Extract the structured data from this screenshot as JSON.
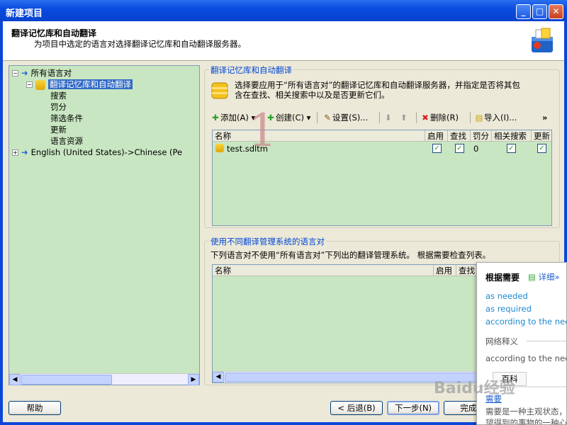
{
  "window": {
    "title": "新建项目"
  },
  "header": {
    "title": "翻译记忆库和自动翻译",
    "subtitle": "为项目中选定的语言对选择翻译记忆库和自动翻译服务器。"
  },
  "tree": {
    "items": [
      {
        "label": "所有语言对"
      },
      {
        "label": "翻译记忆库和自动翻译"
      },
      {
        "label": "搜索"
      },
      {
        "label": "罚分"
      },
      {
        "label": "筛选条件"
      },
      {
        "label": "更新"
      },
      {
        "label": "语言资源"
      },
      {
        "label": "English (United States)->Chinese (Pe"
      }
    ]
  },
  "tm_group": {
    "label": "翻译记忆库和自动翻译",
    "description_line1": "选择要应用于“所有语言对”的翻译记忆库和自动翻译服务器，并指定是否将其包",
    "description_line2": "含在查找、相关搜索中以及是否更新它们。",
    "toolbar": {
      "add": "添加(A)",
      "create": "创建(C)",
      "settings": "设置(S)...",
      "delete": "删除(R)",
      "import": "导入(I)...",
      "more": "»"
    },
    "columns": [
      "名称",
      "启用",
      "查找",
      "罚分",
      "相关搜索",
      "更新"
    ],
    "rows": [
      {
        "name": "test.sdltm",
        "enabled": true,
        "lookup": true,
        "penalty": "0",
        "concordance": true,
        "update": true
      }
    ]
  },
  "other_group": {
    "label": "使用不同翻译管理系统的语言对",
    "description": "下列语言对不使用“所有语言对”下列出的翻译管理系统。 根据需要检查列表。",
    "columns": [
      "名称",
      "启用",
      "查找"
    ]
  },
  "buttons": {
    "help": "帮助",
    "back": "< 后退(B)",
    "next": "下一步(N)",
    "finish": "完成("
  },
  "popup": {
    "title": "根据需要",
    "detail": "详细»",
    "lines": [
      "as needed",
      "as required",
      "according to the need"
    ],
    "net_label": "网络释义",
    "net_value": "according to the need",
    "baike_tab": "百科",
    "baike_title": "需要",
    "baike_text1": "需要是一种主观状态，",
    "baike_text2": "望得到的事物的一种心"
  },
  "overlay": {
    "annotation_number": "1",
    "watermark": "Baidu经验"
  }
}
